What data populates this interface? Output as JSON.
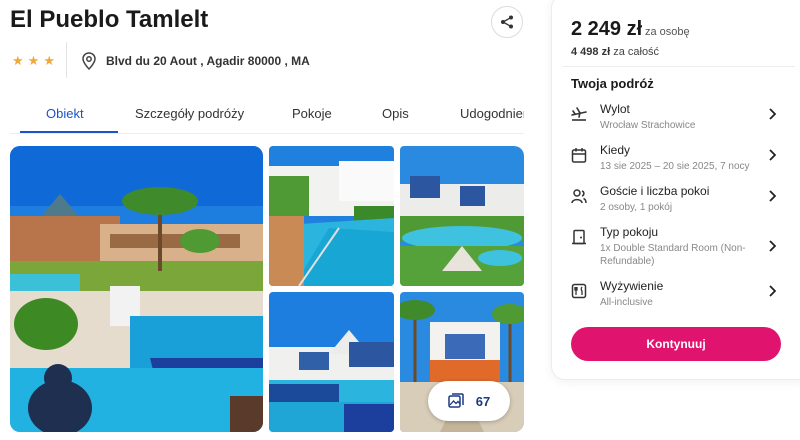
{
  "hotel": {
    "name": "El Pueblo Tamlelt",
    "stars": 3,
    "address": "Blvd du 20 Aout , Agadir 80000 , MA"
  },
  "icons": {
    "share": "share-icon",
    "location": "map-pin-icon",
    "gallery": "gallery-icon",
    "flight": "plane-icon",
    "calendar": "calendar-icon",
    "guests": "users-icon",
    "room": "door-icon",
    "meals": "meals-icon",
    "chevron": "chevron-right-icon"
  },
  "tabs": [
    {
      "label": "Obiekt",
      "active": true
    },
    {
      "label": "Szczegóły podróży",
      "active": false
    },
    {
      "label": "Pokoje",
      "active": false
    },
    {
      "label": "Opis",
      "active": false
    },
    {
      "label": "Udogodnienia",
      "active": false
    }
  ],
  "gallery": {
    "count": "67"
  },
  "booking": {
    "price": "2 249 zł",
    "price_unit": "za osobę",
    "total_amount": "4 498 zł",
    "total_suffix": "za całość",
    "trip_title": "Twoja podróż",
    "items": [
      {
        "label": "Wylot",
        "value": "Wrocław Strachowice"
      },
      {
        "label": "Kiedy",
        "value": "13 sie 2025 – 20 sie 2025, 7 nocy"
      },
      {
        "label": "Goście i liczba pokoi",
        "value": "2 osoby, 1 pokój"
      },
      {
        "label": "Typ pokoju",
        "value": "1x Double Standard Room (Non-Refundable)"
      },
      {
        "label": "Wyżywienie",
        "value": "All-inclusive"
      }
    ],
    "cta": "Kontynuuj"
  },
  "colors": {
    "accent_blue": "#1a54c8",
    "cta_pink": "#e0136e",
    "star": "#f0a83a"
  }
}
